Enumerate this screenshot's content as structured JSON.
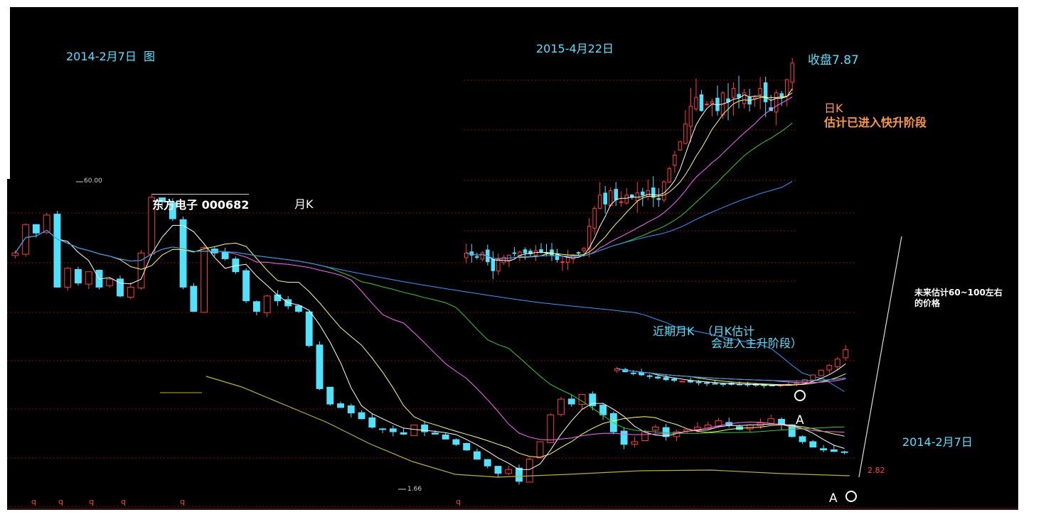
{
  "colors": {
    "background": "#000000",
    "up": "#ff3b3b",
    "down": "#4fe3ff",
    "ma5": "#ffffff",
    "ma10": "#ffff55",
    "ma20": "#ff66ff",
    "ma30": "#33cc33",
    "ma60": "#3399ff",
    "ma_long": "#b7b41a",
    "text_cyan": "#4fe3ff",
    "text_orange": "#ff9a3c"
  },
  "annotations": {
    "monthly_date": "2014-2月7日  图",
    "daily_date": "2015-4月22日",
    "close_price": "收盘7.87",
    "daily_k_line1": "日K",
    "daily_k_line2": "估计已进入快升阶段",
    "stock_name": "东方电子 000682",
    "monthly_k": "月K",
    "future_line1": "未来估计60~100左右",
    "future_line2": "的价格",
    "recent_monthly_line1": "近期月K  （月K估计",
    "recent_monthly_line2": "会进入主升阶段）",
    "marker_a1": "A",
    "marker_a2": "A",
    "bottom_date": "2014-2月7日",
    "price_high": "60.00",
    "price_low": "1.66",
    "price_last": "2.82",
    "q_marker": "q"
  },
  "chart_data": [
    {
      "type": "candlestick",
      "title": "东方电子 000682 月K",
      "period": "monthly",
      "annotated_high": 60.0,
      "annotated_low": 1.66,
      "last_price": 2.82,
      "closes": [
        30,
        42,
        38,
        47,
        20,
        25,
        21,
        24,
        20,
        22,
        18,
        20,
        30,
        58,
        55,
        45,
        20,
        15,
        32,
        30,
        28,
        24,
        17,
        15,
        18,
        17,
        16,
        15,
        10,
        6.0,
        5.0,
        4.8,
        4.5,
        4.2,
        3.8,
        3.7,
        3.6,
        3.5,
        3.9,
        3.6,
        3.5,
        3.3,
        3.1,
        2.9,
        2.6,
        2.4,
        2.2,
        2.3,
        2.0,
        2.6,
        3.2,
        4.4,
        5.3,
        5.0,
        5.6,
        4.9,
        4.4,
        3.6,
        3.1,
        3.2,
        3.6,
        3.8,
        3.4,
        3.6,
        3.7,
        3.8,
        3.9,
        4.1,
        3.9,
        3.7,
        3.9,
        4.0,
        4.2,
        3.9,
        3.4,
        3.2,
        3.0,
        2.9,
        2.85,
        2.82
      ]
    },
    {
      "type": "candlestick",
      "title": "2015-4月22日 日K",
      "period": "daily",
      "last_price": 7.87,
      "closes": [
        3.6,
        3.55,
        3.5,
        3.6,
        3.4,
        3.2,
        3.45,
        3.5,
        3.55,
        3.6,
        3.62,
        3.6,
        3.58,
        3.65,
        3.62,
        3.6,
        3.55,
        3.45,
        3.4,
        3.5,
        3.55,
        3.6,
        3.7,
        4.2,
        4.6,
        4.9,
        4.7,
        5.0,
        4.8,
        4.75,
        4.9,
        4.85,
        4.95,
        4.9,
        5.0,
        4.85,
        4.8,
        5.2,
        5.5,
        5.8,
        6.1,
        6.5,
        6.9,
        7.1,
        6.8,
        6.95,
        7.0,
        6.8,
        7.2,
        7.0,
        7.3,
        7.1,
        7.2,
        6.95,
        7.1,
        7.3,
        7.0,
        6.8,
        7.2,
        7.1,
        7.5,
        7.87
      ]
    },
    {
      "type": "candlestick",
      "title": "近期月K",
      "period": "monthly",
      "closes": [
        4.2,
        4.0,
        3.9,
        3.8,
        3.7,
        3.6,
        3.5,
        3.45,
        3.4,
        3.35,
        3.3,
        3.28,
        3.25,
        3.22,
        3.2,
        3.18,
        3.2,
        3.15,
        3.12,
        3.1,
        3.15,
        3.2,
        3.3,
        3.5,
        3.8,
        4.1,
        4.4,
        4.8,
        5.4
      ]
    }
  ]
}
